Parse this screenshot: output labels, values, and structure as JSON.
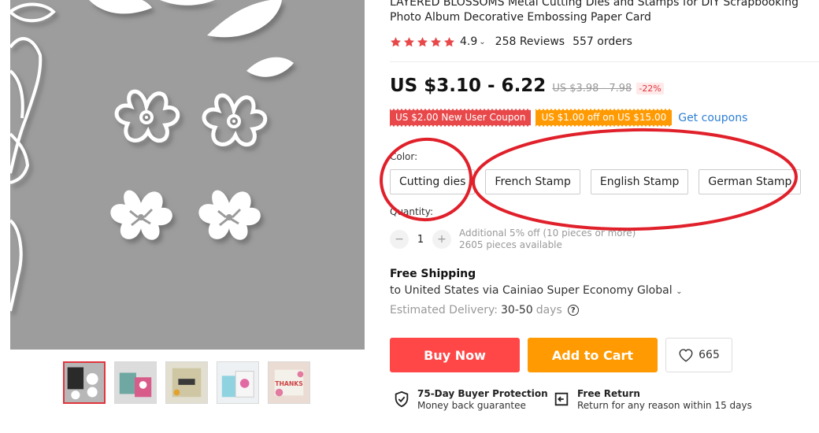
{
  "product": {
    "title": "LAYERED BLOSSOMS Metal Cutting Dies and Stamps for DIY Scrapbooking Photo Album Decorative Embossing Paper Card",
    "rating": "4.9",
    "reviews": "258 Reviews",
    "orders": "557 orders"
  },
  "price": {
    "current": "US $3.10 - 6.22",
    "original": "US $3.98 - 7.98",
    "discount": "-22%"
  },
  "coupons": {
    "new_user": "US $2.00 New User Coupon",
    "store": "US $1.00 off on US $15.00",
    "get_link": "Get coupons"
  },
  "color": {
    "label": "Color:",
    "options": [
      "Cutting dies",
      "French Stamp",
      "English Stamp",
      "German Stamp"
    ]
  },
  "quantity": {
    "label": "Quantity:",
    "value": "1",
    "minus": "−",
    "plus": "+",
    "note_line1": "Additional 5% off (10 pieces or more)",
    "note_line2": "2605 pieces available"
  },
  "shipping": {
    "title": "Free Shipping",
    "line": "to United States via Cainiao Super Economy Global",
    "delivery_label": "Estimated Delivery:",
    "delivery_days": "30-50",
    "delivery_unit": "days"
  },
  "actions": {
    "buy_now": "Buy Now",
    "add_to_cart": "Add to Cart",
    "wishlist_count": "665"
  },
  "guarantees": {
    "protection_title": "75-Day Buyer Protection",
    "protection_sub": "Money back guarantee",
    "return_title": "Free Return",
    "return_sub": "Return for any reason within 15 days"
  },
  "icons": {
    "star": "star-icon",
    "heart": "heart-icon",
    "shield": "shield-check-icon",
    "return": "return-box-icon",
    "help": "question-circle-icon"
  },
  "colors": {
    "accent_red": "#ff4747",
    "orange": "#ff9a02",
    "link_blue": "#2e7fd4",
    "annotation_red": "#e0202a"
  },
  "help_glyph": "?"
}
